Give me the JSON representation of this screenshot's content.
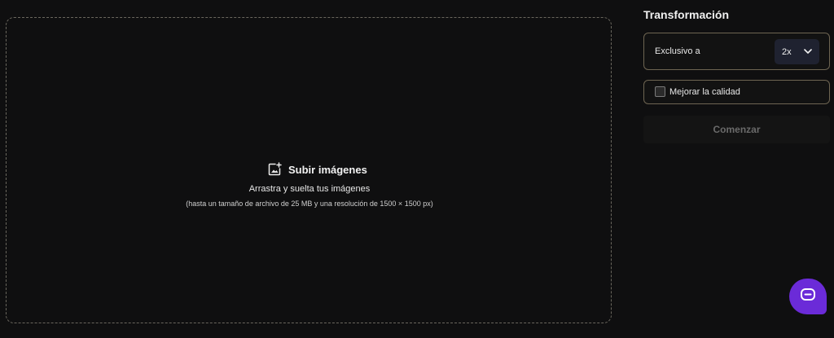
{
  "upload": {
    "button_label": "Subir imágenes",
    "icon": "add-image-icon",
    "drop_text": "Arrastra y suelta tus imágenes",
    "limits_text": "(hasta un tamaño de archivo de 25 MB y una resolución de 1500 × 1500 px)"
  },
  "panel": {
    "title": "Transformación",
    "scale": {
      "label": "Exclusivo a",
      "selected": "2x",
      "icon": "chevron-down-icon"
    },
    "quality": {
      "label": "Mejorar la calidad",
      "checked": false
    },
    "start_label": "Comenzar"
  },
  "chat": {
    "icon": "chat-icon",
    "color": "#6b2bd8"
  },
  "colors": {
    "background": "#0f0f10",
    "border_accent": "#6e6552",
    "select_bg": "#1f2230"
  }
}
